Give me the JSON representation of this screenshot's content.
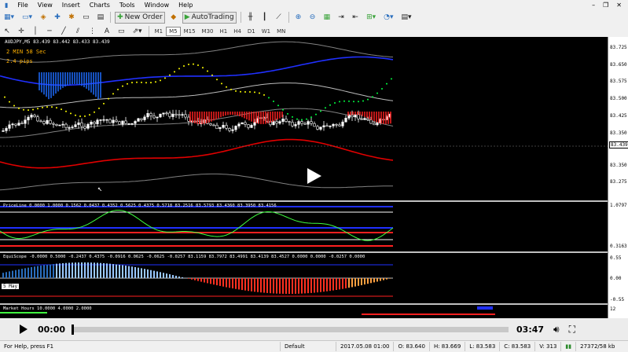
{
  "menu": [
    "File",
    "View",
    "Insert",
    "Charts",
    "Tools",
    "Window",
    "Help"
  ],
  "toolbar": {
    "new_order": "New Order",
    "auto_trading": "AutoTrading"
  },
  "timeframes": [
    "M1",
    "M5",
    "M15",
    "M30",
    "H1",
    "H4",
    "D1",
    "W1",
    "MN"
  ],
  "active_timeframe": "M5",
  "main_chart": {
    "header": "AUDJPY,M5  83.439 83.442 83.433 83.439",
    "timer": "2 MIN 58 Sec",
    "pips": "2.4 pips",
    "current_price": "83.439",
    "axis_labels": [
      "83.725",
      "83.650",
      "83.575",
      "83.500",
      "83.425",
      "83.350",
      "83.275"
    ]
  },
  "sub1": {
    "header": "PriceLine 0.0000 1.0000 0.1562 0.0437 0.4352 0.5625 0.4375 0.5718 83.2516 83.5793 83.4360 83.3950 83.4156",
    "axis_top": "1.0797",
    "axis_bottom": "0.3163"
  },
  "sub2": {
    "header": "EquiScope -0.0000 0.5000 -0.2437 0.4375 -0.0916 0.0625 -0.0625 -0.0257 83.1159 83.7972 83.4991 83.4139 83.4527 0.0000 0.0000 -0.0257 0.0000",
    "axis_labels": [
      "0.55",
      "0.00",
      "-0.55"
    ]
  },
  "sub3": {
    "header": "Market Hours 10.0000 4.0000 2.0000",
    "axis_label": "12"
  },
  "bottom_tab": "5 May",
  "player": {
    "time_current": "00:00",
    "time_total": "03:47"
  },
  "status": {
    "help": "For Help, press F1",
    "profile": "Default",
    "datetime": "2017.05.08 01:00",
    "open": "O: 83.640",
    "high": "H: 83.669",
    "low": "L: 83.583",
    "close": "C: 83.583",
    "volume": "V: 313",
    "traffic": "27372/58 kb"
  },
  "colors": {
    "upper_band": "#2030ff",
    "lower_band": "#e00000",
    "gray_band": "#808080",
    "sar": "#ffff00",
    "bull_hist": "#1e6cff",
    "bear_hist": "#ff2020"
  }
}
